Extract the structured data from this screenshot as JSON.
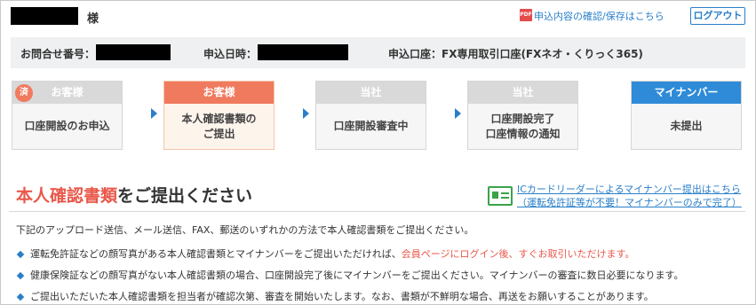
{
  "header": {
    "name_suffix": "様",
    "pdf_icon_label": "PDF",
    "confirm_link": "申込内容の確認/保存はこちら",
    "logout_label": "ログアウト"
  },
  "info": {
    "inquiry_label": "お問合せ番号：",
    "date_label": "申込日時：",
    "account_label": "申込口座：FX専用取引口座(FXネオ・くりっく365)"
  },
  "steps": [
    {
      "head": "お客様",
      "body": "口座開設のお申込",
      "badge": "済"
    },
    {
      "head": "お客様",
      "body": "本人確認書類の\nご提出"
    },
    {
      "head": "当社",
      "body": "口座開設審査中"
    },
    {
      "head": "当社",
      "body": "口座開設完了\n口座情報の通知"
    },
    {
      "head": "マイナンバー",
      "body": "未提出"
    }
  ],
  "section": {
    "title_accent": "本人確認書類",
    "title_rest": "をご提出ください",
    "ic_link": "ICカードリーダーによるマイナンバー提出はこちら",
    "ic_sub": "（運転免許証等が不要！マイナンバーのみで完了）"
  },
  "content": {
    "intro": "下記のアップロード送信、メール送信、FAX、郵送のいずれかの方法で本人確認書類をご提出ください。",
    "bullet1_a": "運転免許証などの顔写真がある本人確認書類とマイナンバーをご提出いただければ、",
    "bullet1_b": "会員ページにログイン後、すぐお取引いただけます。",
    "bullet2": "健康保険証などの顔写真がない本人確認書類の場合、口座開設完了後にマイナンバーをご提出ください。マイナンバーの審査に数日必要になります。",
    "bullet3": "ご提出いただいた本人確認書類を担当者が確認次第、審査を開始いたします。なお、書類が不鮮明な場合、再送をお願いすることがあります。"
  },
  "colors": {
    "accent_red": "#e9584a",
    "link_blue": "#2a7fc9",
    "step_active": "#f07a5e",
    "step_blue": "#2f8bd8",
    "ic_green": "#3aa34a"
  }
}
